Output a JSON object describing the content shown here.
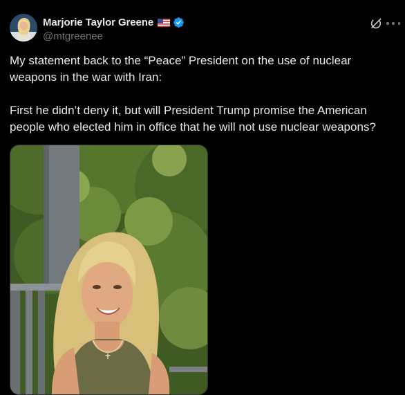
{
  "author": {
    "display_name": "Marjorie Taylor Greene",
    "flag_icon": "us-flag-icon",
    "verified_icon": "verified-badge-icon",
    "handle": "@mtgreenee"
  },
  "post": {
    "paragraph_1": "My statement back to the “Peace” President on the use of nuclear weapons in the war with Iran:",
    "paragraph_2": "First he didn’t deny it, but will President Trump promise the American people who elected him in office that he will not use nuclear weapons?"
  },
  "toolbar": {
    "grok_icon": "grok-icon",
    "more_icon": "more-options-icon"
  },
  "colors": {
    "background": "#000000",
    "text": "#e7e9ea",
    "secondary_text": "#71767b",
    "verified_blue": "#1d9bf0"
  }
}
